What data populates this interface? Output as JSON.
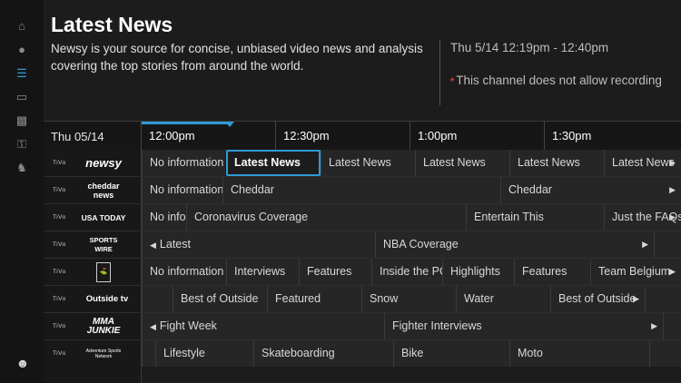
{
  "sidebar": {
    "icons": [
      "home-icon",
      "record-icon",
      "guide-icon",
      "tv-icon",
      "movies-icon",
      "sports-icon",
      "kids-icon"
    ],
    "logo": "tivo-logo-icon",
    "active_index": 2,
    "accent_color": "#2f9bd6"
  },
  "program": {
    "title": "Latest News",
    "description": "Newsy is your source for concise, unbiased video news and analysis covering the top stories from around the world.",
    "airtime": "Thu 5/14 12:19pm - 12:40pm",
    "recording_note": "This channel does not allow recording",
    "recording_mark": "*"
  },
  "guide": {
    "date": "Thu 05/14",
    "times": [
      "12:00pm",
      "12:30pm",
      "1:00pm",
      "1:30pm"
    ],
    "tivo_tag": "TiVo",
    "rows": [
      {
        "channel": "newsy",
        "cells": [
          "No information",
          "Latest News",
          "Latest News",
          "Latest News",
          "Latest News",
          "Latest News"
        ]
      },
      {
        "channel": "cheddar news",
        "cells": [
          "No information",
          "Cheddar",
          "Cheddar"
        ]
      },
      {
        "channel": "USA TODAY",
        "cells": [
          "No information",
          "Coronavirus Coverage",
          "Entertain This",
          "Just the FAQs"
        ]
      },
      {
        "channel": "SPORTS WIRE",
        "cells": [
          "Latest",
          "NBA Coverage"
        ]
      },
      {
        "channel": "golf",
        "cells": [
          "No information",
          "Interviews",
          "Features",
          "Inside the PGA",
          "Highlights",
          "Features",
          "Team Belgium"
        ]
      },
      {
        "channel": "Outside tv",
        "cells": [
          "",
          "Best of Outside",
          "Featured",
          "Snow",
          "Water",
          "Best of Outside"
        ]
      },
      {
        "channel": "MMA JUNKIE",
        "cells": [
          "Fight Week",
          "Fighter Interviews"
        ]
      },
      {
        "channel": "Adventure Sports Network",
        "cells": [
          "",
          "Lifestyle",
          "Skateboarding",
          "Bike",
          "Moto"
        ]
      }
    ]
  }
}
